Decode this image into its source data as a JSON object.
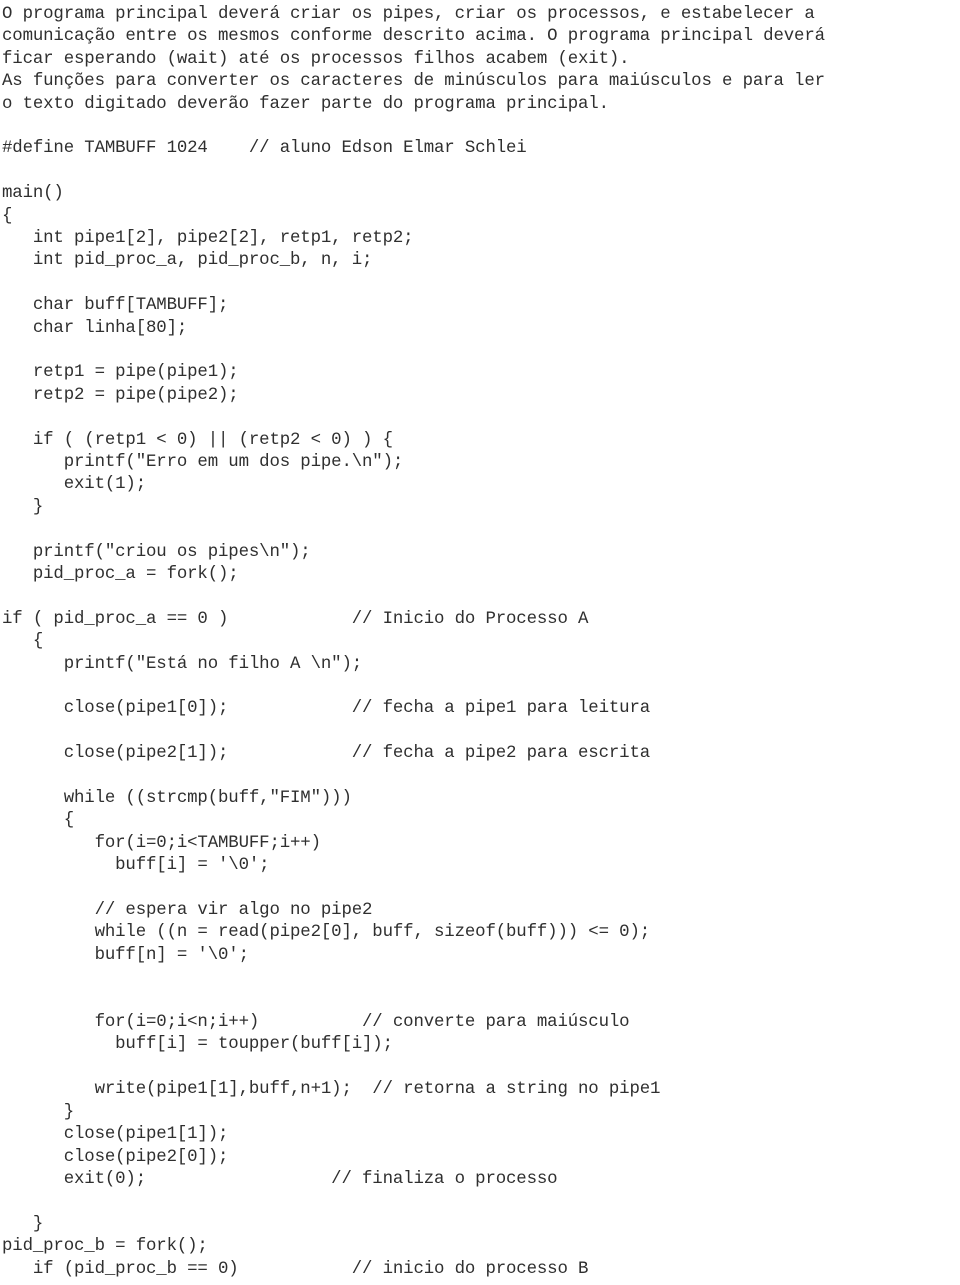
{
  "document": {
    "kind": "scanned-code-listing",
    "language": "C",
    "text_color": "#2f2f2f",
    "background_color": "#ffffff",
    "intro_paragraph": "O programa principal deverá criar os pipes, criar os processos, e estabelecer a\ncomunicação entre os mesmos conforme descrito acima. O programa principal deverá\nficar esperando (wait) até os processos filhos acabem (exit).\nAs funções para converter os caracteres de minúsculos para maiúsculos e para ler\no texto digitado deverão fazer parte do programa principal.",
    "code_lines": [
      "#define TAMBUFF 1024    // aluno Edson Elmar Schlei",
      "",
      "main()",
      "{",
      "   int pipe1[2], pipe2[2], retp1, retp2;",
      "   int pid_proc_a, pid_proc_b, n, i;",
      "",
      "   char buff[TAMBUFF];",
      "   char linha[80];",
      "",
      "   retp1 = pipe(pipe1);",
      "   retp2 = pipe(pipe2);",
      "",
      "   if ( (retp1 < 0) || (retp2 < 0) ) {",
      "      printf(\"Erro em um dos pipe.\\n\");",
      "      exit(1);",
      "   }",
      "",
      "   printf(\"criou os pipes\\n\");",
      "   pid_proc_a = fork();",
      "",
      "if ( pid_proc_a == 0 )            // Inicio do Processo A",
      "   {",
      "      printf(\"Está no filho A \\n\");",
      "",
      "      close(pipe1[0]);            // fecha a pipe1 para leitura",
      "",
      "      close(pipe2[1]);            // fecha a pipe2 para escrita",
      "",
      "      while ((strcmp(buff,\"FIM\")))",
      "      {",
      "         for(i=0;i<TAMBUFF;i++)",
      "           buff[i] = '\\0';",
      "",
      "         // espera vir algo no pipe2",
      "         while ((n = read(pipe2[0], buff, sizeof(buff))) <= 0);",
      "         buff[n] = '\\0';",
      "",
      "",
      "         for(i=0;i<n;i++)          // converte para maiúsculo",
      "           buff[i] = toupper(buff[i]);",
      "",
      "         write(pipe1[1],buff,n+1);  // retorna a string no pipe1",
      "      }",
      "      close(pipe1[1]);",
      "      close(pipe2[0]);",
      "      exit(0);                  // finaliza o processo",
      "",
      "   }",
      "pid_proc_b = fork();",
      "   if (pid_proc_b == 0)           // inicio do processo B"
    ]
  }
}
